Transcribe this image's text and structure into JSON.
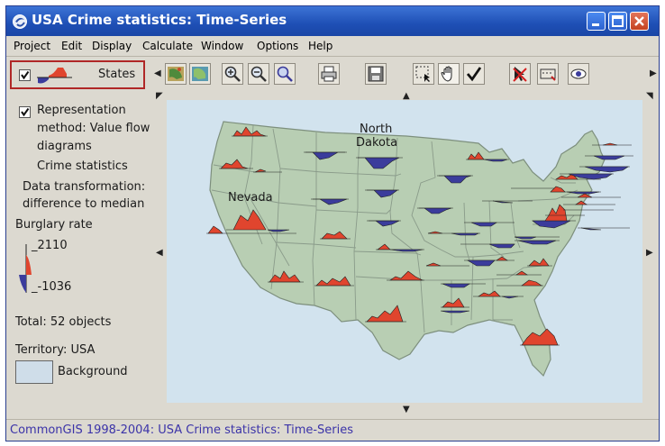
{
  "window": {
    "title": "USA Crime statistics: Time-Series"
  },
  "menu": {
    "items": [
      "Project",
      "Edit",
      "Display",
      "Calculate",
      "Window",
      "Options",
      "Help"
    ]
  },
  "layer": {
    "name": "States",
    "checked": true
  },
  "legend": {
    "representation": [
      "Representation",
      "method: Value flow",
      "diagrams"
    ],
    "attribute": "Crime statistics",
    "transformation": [
      "Data transformation:",
      "difference to median"
    ],
    "variable": "Burglary rate",
    "max_value": "_2110",
    "min_value": "_-1036",
    "total": "Total: 52 objects",
    "territory": "Territory: USA",
    "background_label": "Background"
  },
  "toolbar": {
    "icons": [
      "map-icon",
      "map-layers-icon",
      "zoom-in-icon",
      "zoom-out-icon",
      "zoom-fit-icon",
      "print-icon",
      "save-icon",
      "select-icon",
      "pan-hand-icon",
      "check-icon",
      "cancel-selection-icon",
      "measure-icon",
      "eye-icon"
    ]
  },
  "map": {
    "labels": {
      "nevada": "Nevada",
      "north_dakota_line1": "North",
      "north_dakota_line2": "Dakota"
    },
    "colors": {
      "land": "#b8ceb3",
      "border": "#8a9b8a",
      "positive": "#e0452e",
      "negative": "#3b3c9c",
      "water": "#d2e3ee"
    }
  },
  "status": "CommonGIS 1998-2004: USA Crime statistics: Time-Series"
}
